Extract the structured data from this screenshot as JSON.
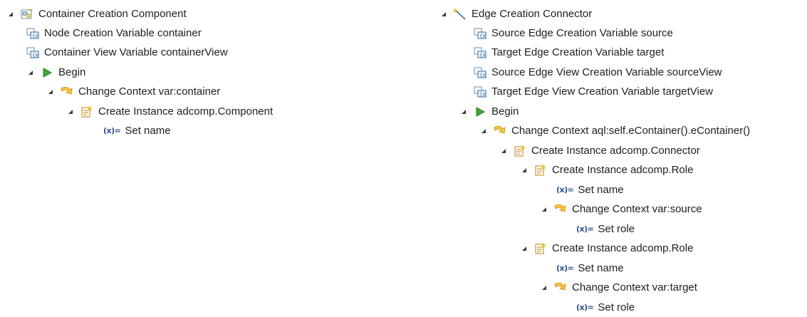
{
  "left_tree": {
    "root": {
      "label": "Container Creation Component",
      "icon": "container-creation-icon"
    },
    "var1": {
      "label": "Node Creation Variable container",
      "icon": "variable-icon"
    },
    "var2": {
      "label": "Container View Variable containerView",
      "icon": "variable-icon"
    },
    "begin": {
      "label": "Begin",
      "icon": "begin-play-icon"
    },
    "change_context": {
      "label": "Change Context var:container",
      "icon": "change-context-icon"
    },
    "create_instance": {
      "label": "Create Instance adcomp.Component",
      "icon": "create-instance-icon"
    },
    "set_name": {
      "icon_text": "(x)=",
      "label": "Set name"
    }
  },
  "right_tree": {
    "root": {
      "label": "Edge Creation Connector",
      "icon": "edge-creation-icon"
    },
    "var1": {
      "label": "Source Edge Creation Variable source",
      "icon": "variable-icon"
    },
    "var2": {
      "label": "Target Edge Creation Variable target",
      "icon": "variable-icon"
    },
    "var3": {
      "label": "Source Edge View Creation Variable sourceView",
      "icon": "variable-icon"
    },
    "var4": {
      "label": "Target Edge View Creation Variable targetView",
      "icon": "variable-icon"
    },
    "begin": {
      "label": "Begin",
      "icon": "begin-play-icon"
    },
    "change_context": {
      "label": "Change Context aql:self.eContainer().eContainer()",
      "icon": "change-context-icon"
    },
    "create_connector": {
      "label": "Create Instance adcomp.Connector",
      "icon": "create-instance-icon"
    },
    "create_role1": {
      "label": "Create Instance adcomp.Role",
      "icon": "create-instance-icon"
    },
    "set_name1": {
      "icon_text": "(x)=",
      "label": "Set name"
    },
    "change_source": {
      "label": "Change Context var:source",
      "icon": "change-context-icon"
    },
    "set_role1": {
      "icon_text": "(x)=",
      "label": "Set role"
    },
    "create_role2": {
      "label": "Create Instance adcomp.Role",
      "icon": "create-instance-icon"
    },
    "set_name2": {
      "icon_text": "(x)=",
      "label": "Set name"
    },
    "change_target": {
      "label": "Change Context var:target",
      "icon": "change-context-icon"
    },
    "set_role2": {
      "icon_text": "(x)=",
      "label": "Set role"
    }
  },
  "colors": {
    "text": "#1e1e1e",
    "twisty": "#3c3c3c",
    "begin_green": "#3fa535",
    "context_yellow": "#f2b51c",
    "variable_blue": "#3b6ea5"
  }
}
